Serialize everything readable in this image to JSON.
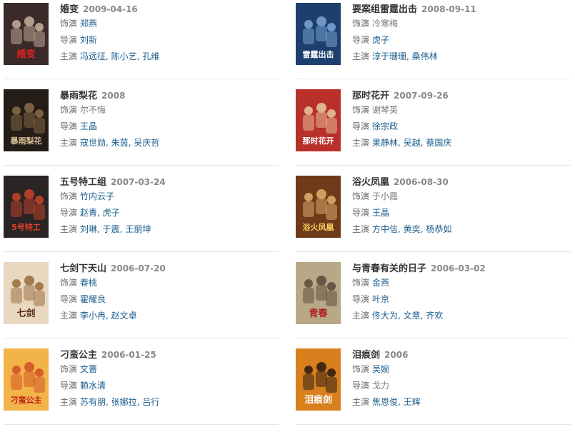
{
  "labels": {
    "role": "饰演",
    "director": "导演",
    "cast": "主演",
    "sep": ", "
  },
  "films": [
    {
      "title": "婚变",
      "date": "2009-04-16",
      "role": "郑燕",
      "role_link": true,
      "director": "刘新",
      "director_link": true,
      "cast": [
        "冯远征",
        "陈小艺",
        "孔维"
      ],
      "poster": {
        "bg": "#3a2a2a",
        "accent": "#c9b0a0",
        "text": "婚变",
        "text_color": "#e02020"
      }
    },
    {
      "title": "要案组雷霆出击",
      "date": "2008-09-11",
      "role": "冷寒梅",
      "role_link": false,
      "director": "虎子",
      "director_link": true,
      "cast": [
        "淳于珊珊",
        "桑伟林"
      ],
      "poster": {
        "bg": "#1d3f6e",
        "accent": "#7ea6d6",
        "text": "雷霆出击",
        "text_color": "#ffffff"
      }
    },
    {
      "title": "暴雨梨花",
      "date": "2008",
      "role": "尔不悔",
      "role_link": false,
      "director": "王晶",
      "director_link": true,
      "cast": [
        "寇世勋",
        "朱茵",
        "吴庆哲"
      ],
      "poster": {
        "bg": "#231c17",
        "accent": "#8b6c4a",
        "text": "暴雨梨花",
        "text_color": "#d9c29a"
      }
    },
    {
      "title": "那时花开",
      "date": "2007-09-26",
      "role": "谢琴英",
      "role_link": false,
      "director": "徐宗政",
      "director_link": true,
      "cast": [
        "果静林",
        "吴越",
        "蔡国庆"
      ],
      "poster": {
        "bg": "#b9302a",
        "accent": "#e7c8a0",
        "text": "那时花开",
        "text_color": "#ffffff"
      }
    },
    {
      "title": "五号特工组",
      "date": "2007-03-24",
      "role": "竹内云子",
      "role_link": true,
      "director": "赵青",
      "director_link": true,
      "director2": "虎子",
      "cast": [
        "刘琳",
        "于震",
        "王丽坤"
      ],
      "poster": {
        "bg": "#2a2424",
        "accent": "#c8442a",
        "text": "5号特工",
        "text_color": "#e0402a"
      }
    },
    {
      "title": "浴火凤凰",
      "date": "2006-08-30",
      "role": "于小霞",
      "role_link": false,
      "director": "王晶",
      "director_link": true,
      "cast": [
        "方中信",
        "黄奕",
        "杨恭如"
      ],
      "poster": {
        "bg": "#6e3a18",
        "accent": "#e0b070",
        "text": "浴火凤凰",
        "text_color": "#f3d060"
      }
    },
    {
      "title": "七剑下天山",
      "date": "2006-07-20",
      "role": "春桃",
      "role_link": true,
      "director": "霍耀良",
      "director_link": true,
      "cast": [
        "李小冉",
        "赵文卓"
      ],
      "poster": {
        "bg": "#e8d8c0",
        "accent": "#9a6a3a",
        "text": "七剑",
        "text_color": "#5a2a10"
      }
    },
    {
      "title": "与青春有关的日子",
      "date": "2006-03-02",
      "role": "金燕",
      "role_link": true,
      "director": "叶京",
      "director_link": true,
      "cast": [
        "佟大为",
        "文章",
        "齐欢"
      ],
      "poster": {
        "bg": "#b8a888",
        "accent": "#5a4a3a",
        "text": "青春",
        "text_color": "#b02020"
      }
    },
    {
      "title": "刁蛮公主",
      "date": "2006-01-25",
      "role": "文蔷",
      "role_link": true,
      "director": "赖水清",
      "director_link": true,
      "cast": [
        "苏有朋",
        "张娜拉",
        "吕行"
      ],
      "poster": {
        "bg": "#f2b448",
        "accent": "#d0502a",
        "text": "刁蛮公主",
        "text_color": "#c01818"
      }
    },
    {
      "title": "泪痕剑",
      "date": "2006",
      "role": "吴婉",
      "role_link": true,
      "director": "戈力",
      "director_link": false,
      "cast": [
        "焦恩俊",
        "王辉"
      ],
      "poster": {
        "bg": "#d8801e",
        "accent": "#2a1a10",
        "text": "泪痕剑",
        "text_color": "#ffffff"
      }
    }
  ]
}
